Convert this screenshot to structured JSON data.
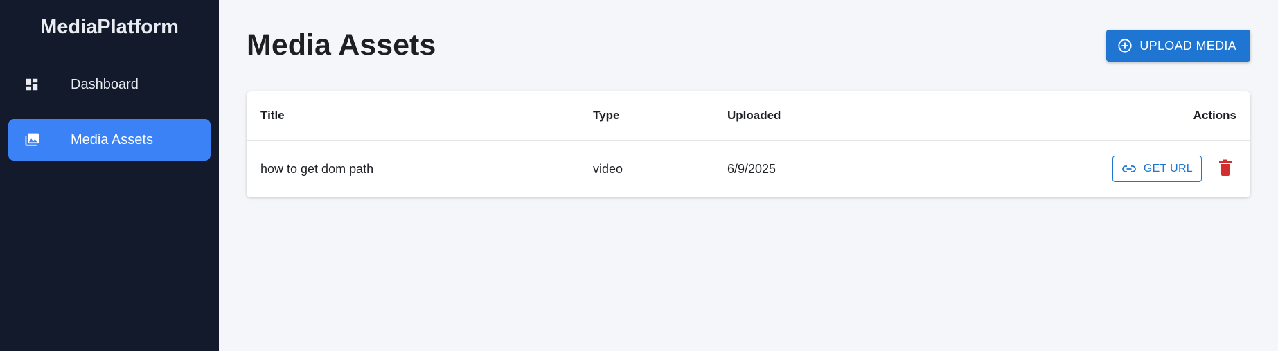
{
  "brand": {
    "name": "MediaPlatform"
  },
  "sidebar": {
    "items": [
      {
        "label": "Dashboard",
        "icon": "dashboard-icon",
        "active": false
      },
      {
        "label": "Media Assets",
        "icon": "photo-library-icon",
        "active": true
      }
    ]
  },
  "header": {
    "title": "Media Assets",
    "upload_label": "UPLOAD MEDIA",
    "upload_icon": "add-circle-icon"
  },
  "table": {
    "columns": [
      "Title",
      "Type",
      "Uploaded",
      "Actions"
    ],
    "rows": [
      {
        "title": "how to get dom path",
        "type": "video",
        "uploaded": "6/9/2025",
        "get_url_label": "GET URL"
      }
    ]
  },
  "colors": {
    "sidebar_bg": "#121a2b",
    "active_item": "#3b82f6",
    "primary": "#1f76d2",
    "danger": "#d32f2f",
    "page_bg": "#f5f6f9"
  }
}
